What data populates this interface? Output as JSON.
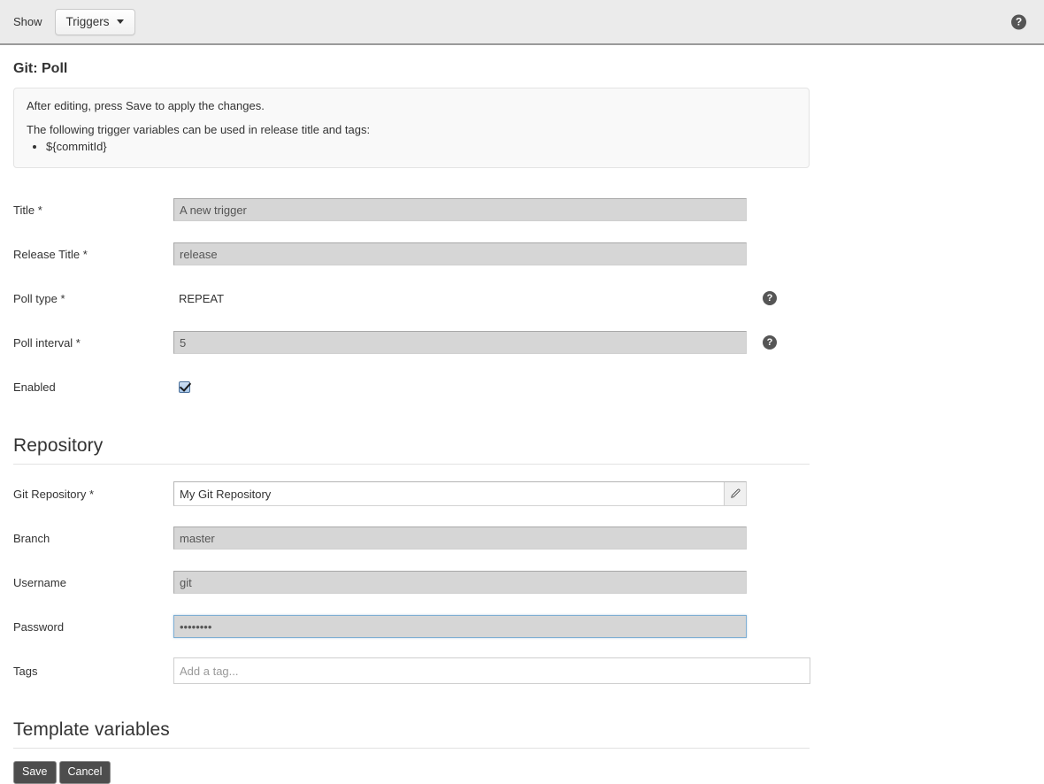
{
  "topbar": {
    "show_label": "Show",
    "dropdown_label": "Triggers",
    "help_icon_glyph": "?",
    "help_icon_name": "help-circle-icon"
  },
  "page": {
    "title": "Git: Poll"
  },
  "info_box": {
    "line1": "After editing, press Save to apply the changes.",
    "line2": "The following trigger variables can be used in release title and tags:",
    "variables": [
      "${commitId}"
    ]
  },
  "form": {
    "fields": [
      {
        "label": "Title *",
        "value": "A new trigger",
        "type": "text-disabled"
      },
      {
        "label": "Release Title *",
        "value": "release",
        "type": "text-disabled"
      },
      {
        "label": "Poll type *",
        "value": "REPEAT",
        "type": "static",
        "help": "?"
      },
      {
        "label": "Poll interval *",
        "value": "5",
        "type": "text-disabled",
        "help": "?"
      },
      {
        "label": "Enabled",
        "value": "checked",
        "type": "checkbox"
      }
    ]
  },
  "repository_section": {
    "heading": "Repository",
    "git_repository": {
      "label": "Git Repository *",
      "value": "My Git Repository",
      "edit_icon": "pencil-icon"
    },
    "branch": {
      "label": "Branch",
      "value": "master"
    },
    "username": {
      "label": "Username",
      "value": "git"
    },
    "password": {
      "label": "Password",
      "value": "••••••••"
    },
    "tags": {
      "label": "Tags",
      "value": "",
      "placeholder": "Add a tag..."
    }
  },
  "template_variables_section": {
    "heading": "Template variables"
  },
  "actions": {
    "save_label": "Save",
    "cancel_label": "Cancel"
  },
  "colors": {
    "topbar_bg": "#ebebeb",
    "button_dark": "#4d4d4d",
    "disabled_field_bg": "#d6d6d6",
    "focus_border": "#7eaed3",
    "checkbox_blue": "#a9c8ea"
  }
}
